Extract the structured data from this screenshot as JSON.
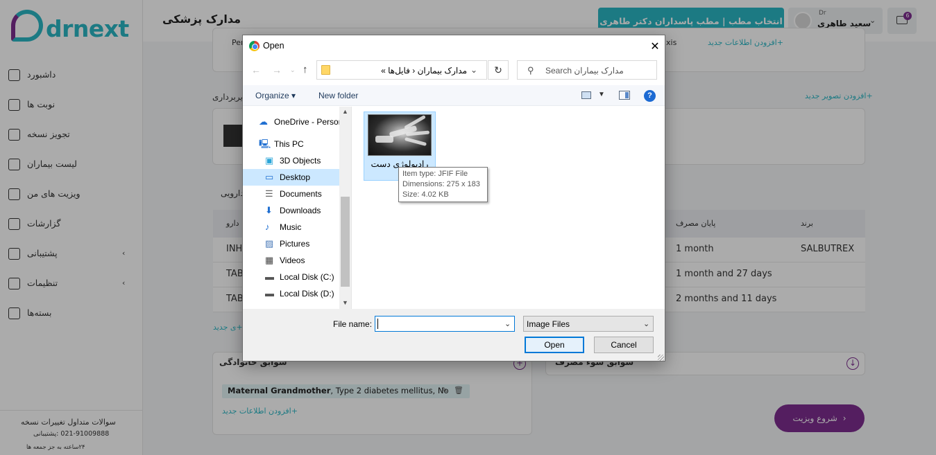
{
  "app": {
    "brand": "drnext",
    "page_title": "مدارک پزشکی",
    "clinic_button": "انتخاب مطب | مطب پاسداران دکتر طاهری",
    "user": {
      "role": "Dr",
      "name": "سعید طاهری"
    },
    "notification_count": "6",
    "sidebar": {
      "items": [
        {
          "label": "داشبورد",
          "icon": "home-icon"
        },
        {
          "label": "نوبت ها",
          "icon": "calendar-icon"
        },
        {
          "label": "تجویز نسخه",
          "icon": "edit-icon"
        },
        {
          "label": "لیست بیماران",
          "icon": "list-icon"
        },
        {
          "label": "ویزیت های من",
          "icon": "list-icon"
        },
        {
          "label": "گزارشات",
          "icon": "calendar-icon"
        },
        {
          "label": "پشتیبانی",
          "icon": "headset-icon",
          "submenu": true
        },
        {
          "label": "تنظیمات",
          "icon": "gear-icon",
          "submenu": true
        },
        {
          "label": "بسته‌ها",
          "icon": "box-icon"
        }
      ],
      "footer": {
        "links": "سوالات متداول   تغییرات نسخه",
        "phone": "021-91009888  :پشتیبانی",
        "hours": "۲۴ساعته به جز جمعه ها"
      }
    },
    "imaging": {
      "section": "تصویربرداری",
      "add_link": "+افزودن تصویر جدید"
    },
    "drug_section": "دارویی",
    "top_links": {
      "partial": "Per",
      "xis": "xis",
      "add_info": "+افزودن اطلاعات جدید"
    },
    "table": {
      "headers": {
        "brand": "برند",
        "end_use": "پایان مصرف",
        "drug": "دارو"
      },
      "rows": [
        {
          "drug": "INH",
          "end_use": "1 month",
          "brand": "SALBUTREX"
        },
        {
          "drug": "TAB",
          "end_use": "1 month and 27 days",
          "brand": ""
        },
        {
          "drug": "TAB",
          "end_use": "2 months and 11 days",
          "brand": ""
        }
      ],
      "add_link": "+ی جدید"
    },
    "family_history": {
      "title": "سوابق خانوادگی",
      "item_bold": "Maternal Grandmother",
      "item_rest": ", Type 2 diabetes mellitus, No",
      "add_link": "+افزودن اطلاعات جدید"
    },
    "substance_history": {
      "title": "سوابق سوء مصرف"
    },
    "start_visit": "شروع ویزیت"
  },
  "dialog": {
    "title": "Open",
    "address": {
      "path": "مدارک بیماران  ‹  فایل‌ها  »"
    },
    "search_placeholder": "Search مدارک بیماران",
    "toolbar": {
      "organize": "Organize ▾",
      "new_folder": "New folder",
      "help": "?"
    },
    "tree": [
      {
        "label": "OneDrive - Person",
        "icon": "cloud-icon",
        "indent": 0
      },
      {
        "label": "This PC",
        "icon": "computer-icon",
        "indent": 0
      },
      {
        "label": "3D Objects",
        "icon": "cube-icon",
        "indent": 1
      },
      {
        "label": "Desktop",
        "icon": "desktop-icon",
        "indent": 1,
        "selected": true
      },
      {
        "label": "Documents",
        "icon": "document-icon",
        "indent": 1
      },
      {
        "label": "Downloads",
        "icon": "download-icon",
        "indent": 1
      },
      {
        "label": "Music",
        "icon": "music-icon",
        "indent": 1
      },
      {
        "label": "Pictures",
        "icon": "picture-icon",
        "indent": 1
      },
      {
        "label": "Videos",
        "icon": "video-icon",
        "indent": 1
      },
      {
        "label": "Local Disk (C:)",
        "icon": "disk-icon",
        "indent": 1
      },
      {
        "label": "Local Disk (D:)",
        "icon": "disk-icon",
        "indent": 1
      }
    ],
    "file": {
      "name": "رادیولوژی دست",
      "name_line2": "ت"
    },
    "tooltip": {
      "type": "Item type: JFIF File",
      "dimensions": "Dimensions: 275 x 183",
      "size": "Size: 4.02 KB"
    },
    "file_name_label": "File name:",
    "file_name_value": "",
    "filter": "Image Files",
    "open_button": "Open",
    "cancel_button": "Cancel"
  },
  "colors": {
    "teal": "#2bb6c4",
    "purple": "#7e2d8f",
    "selection": "#cce8ff"
  }
}
